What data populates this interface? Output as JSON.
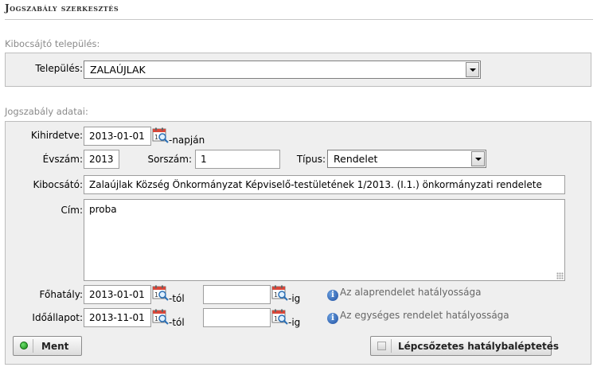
{
  "page": {
    "title": "Jogszabály szerkesztés"
  },
  "issuer_section": {
    "label": "Kibocsájtó település:",
    "settlement_label": "Település:",
    "settlement_value": "ZALAÚJLAK"
  },
  "data_section": {
    "label": "Jogszabály adatai:",
    "promulgated_label": "Kihirdetve:",
    "promulgated_value": "2013-01-01",
    "promulgated_suffix": "-napján",
    "year_label": "Évszám:",
    "year_value": "2013",
    "serial_label": "Sorszám:",
    "serial_value": "1",
    "type_label": "Típus:",
    "type_value": "Rendelet",
    "issuer_label": "Kibocsátó:",
    "issuer_value": "Zalaújlak Község Önkormányzat Képviselő-testületének 1/2013. (I.1.) önkormányzati rendelete",
    "title_label": "Cím:",
    "title_value": "proba",
    "main_effect_label": "Főhatály:",
    "main_effect_from": "2013-01-01",
    "main_effect_from_suffix": "-tól",
    "main_effect_to": "",
    "main_effect_to_suffix": "-ig",
    "main_effect_info": "Az alaprendelet hatályossága",
    "timestate_label": "Időállapot:",
    "timestate_from": "2013-11-01",
    "timestate_from_suffix": "-tól",
    "timestate_to": "",
    "timestate_to_suffix": "-ig",
    "timestate_info": "Az egységes rendelet hatályossága"
  },
  "buttons": {
    "save_label": "Ment",
    "stepwise_label": "Lépcsőzetes hatálybaléptetés"
  },
  "icons": {
    "calendar": "calendar-search-icon",
    "info": "info-icon",
    "dropdown": "chevron-down-icon"
  },
  "colors": {
    "panel_bg": "#efefef",
    "save_indicator": "#1a9a1a",
    "info_blue": "#1f4fa0"
  }
}
